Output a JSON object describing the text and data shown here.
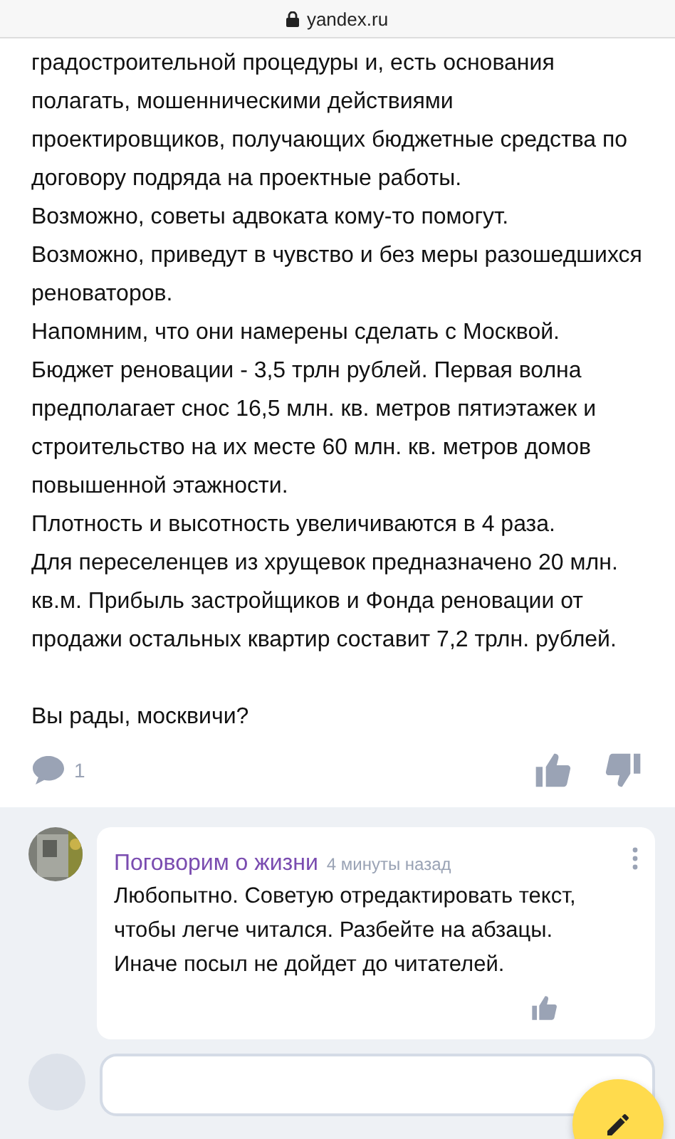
{
  "address_bar": {
    "url": "yandex.ru"
  },
  "article": {
    "paragraphs": [
      "градостроительной процедуры и, есть основания полагать, мошенническими действиями проектировщиков, получающих бюджетные средства по договору подряда на проектные работы.",
      "Возможно, советы адвоката кому-то помогут.",
      "Возможно, приведут в чувство и без меры разошедшихся реноваторов.",
      "Напомним, что они намерены сделать с Москвой.",
      "Бюджет реновации - 3,5 трлн рублей. Первая волна предполагает снос 16,5 млн. кв. метров пятиэтажек и строительство на их месте 60 млн. кв. метров домов повышенной этажности.",
      "Плотность и высотность увеличиваются в 4 раза.",
      "Для переселенцев из хрущевок предназначено 20 млн. кв.м. Прибыль застройщиков и Фонда реновации от продажи остальных квартир составит 7,2 трлн. рублей."
    ],
    "closing": "Вы рады, москвичи?",
    "comment_count": "1"
  },
  "comments": [
    {
      "author": "Поговорим о жизни",
      "time": "4 минуты назад",
      "text": "Любопытно. Советую отредактировать текст, чтобы легче читался. Разбейте на абзацы. Иначе посыл не дойдет до читателей."
    }
  ]
}
